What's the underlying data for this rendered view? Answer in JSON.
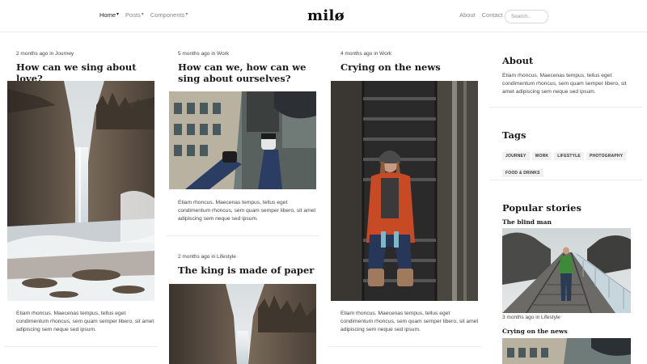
{
  "nav": {
    "left": [
      {
        "label": "Home",
        "caret": "▾",
        "active": true
      },
      {
        "label": "Posts",
        "caret": "▾",
        "active": false
      },
      {
        "label": "Components",
        "caret": "▾",
        "active": false
      }
    ],
    "brand": "milø",
    "right": [
      {
        "label": "About"
      },
      {
        "label": "Contact"
      }
    ],
    "search_placeholder": "Search.."
  },
  "posts": [
    {
      "meta": "2 months ago in Journey",
      "title": "How can we sing about love?",
      "excerpt": "Etiam rhoncus. Maecenas tempus, tellus eget condimentum rhoncus, sem quam semper libero, sit amet adipiscing sem neque sed ipsum.",
      "image": "waterfall-image"
    },
    {
      "meta": "5 months ago in Work",
      "title": "How can we, how can we sing about ourselves?",
      "excerpt": "Etiam rhoncus. Maecenas tempus, tellus eget condimentum rhoncus, sem quam semper libero, sit amet adipiscing sem neque sed ipsum.",
      "image": "rooftop-legs-image"
    },
    {
      "meta": "2 months ago in Lifestyle",
      "title": "The king is made of paper",
      "image": "waterfall-image"
    },
    {
      "meta": "4 months ago in Work",
      "title": "Crying on the news",
      "excerpt": "Etiam rhoncus. Maecenas tempus, tellus eget condimentum rhoncus, sem quam semper libero, sit amet adipiscing sem neque sed ipsum.",
      "image": "girl-on-stairs-image"
    }
  ],
  "sidebar": {
    "about_title": "About",
    "about_text": "Etiam rhoncus. Maecenas tempus, tellus eget condimentum rhoncus, sem quam semper libero, sit amet adipiscing sem neque sed ipsum.",
    "tags_title": "Tags",
    "tags": [
      "JOURNEY",
      "WORK",
      "LIFESTYLE",
      "PHOTOGRAPHY",
      "FOOD & DRINKS"
    ],
    "popular_title": "Popular stories",
    "stories": [
      {
        "title": "The blind man",
        "meta": "3 months ago in Lifestyle",
        "image": "railway-man-image"
      },
      {
        "title": "Crying on the news",
        "image": "rooftop-legs-image"
      }
    ]
  },
  "colors": {
    "accent_blue": "#6fa8d6",
    "link_gray": "#888888",
    "tag_bg": "#f1f1f1"
  }
}
